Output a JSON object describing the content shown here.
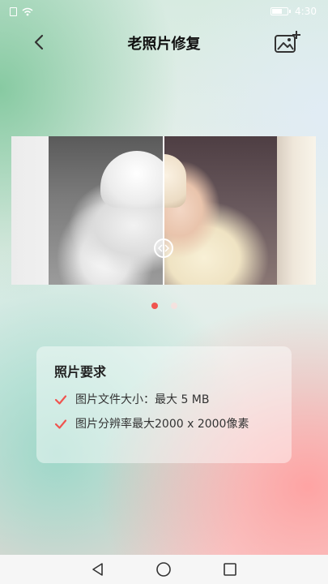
{
  "status_bar": {
    "time": "4:30"
  },
  "header": {
    "title": "老照片修复"
  },
  "carousel": {
    "active_index": 0,
    "total": 2
  },
  "requirements": {
    "title": "照片要求",
    "items": [
      "图片文件大小：最大 5 MB",
      "图片分辨率最大2000 x 2000像素"
    ]
  },
  "colors": {
    "accent": "#f0544f",
    "title_text": "#111111",
    "body_text": "#333333"
  },
  "icons": {
    "back": "chevron-left-icon",
    "gallery": "image-add-icon",
    "check": "check-icon",
    "compare": "compare-handle-icon",
    "nav_back": "triangle-back-icon",
    "nav_home": "circle-home-icon",
    "nav_recent": "square-recent-icon"
  }
}
